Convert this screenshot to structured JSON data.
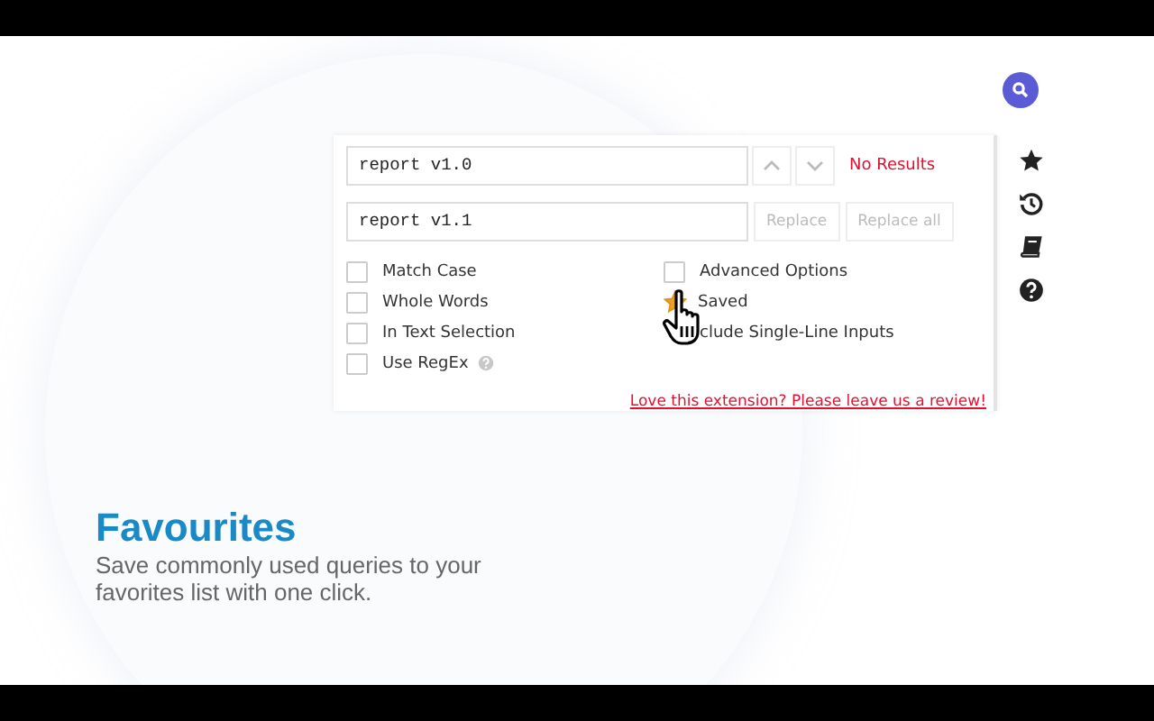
{
  "find": {
    "value": "report v1.0",
    "status": "No Results"
  },
  "replace": {
    "value": "report v1.1",
    "buttons": [
      {
        "label": "Replace",
        "disabled": true
      },
      {
        "label": "Replace all",
        "disabled": true
      }
    ]
  },
  "options_left": [
    {
      "kind": "checkbox",
      "label": "Match Case",
      "checked": false
    },
    {
      "kind": "checkbox",
      "label": "Whole Words",
      "checked": false
    },
    {
      "kind": "checkbox",
      "label": "In Text Selection",
      "checked": false
    },
    {
      "kind": "checkbox",
      "label": "Use RegEx",
      "checked": false,
      "help": true
    }
  ],
  "options_right": [
    {
      "kind": "checkbox",
      "label": "Advanced Options",
      "checked": false
    },
    {
      "kind": "star",
      "label": "Saved",
      "checked": true
    },
    {
      "kind": "covered",
      "label": "clude Single-Line Inputs"
    }
  ],
  "review_link": "Love this extension? Please leave us a review!",
  "feature": {
    "title": "Favourites",
    "description": "Save commonly used queries to your favorites list with one click."
  }
}
